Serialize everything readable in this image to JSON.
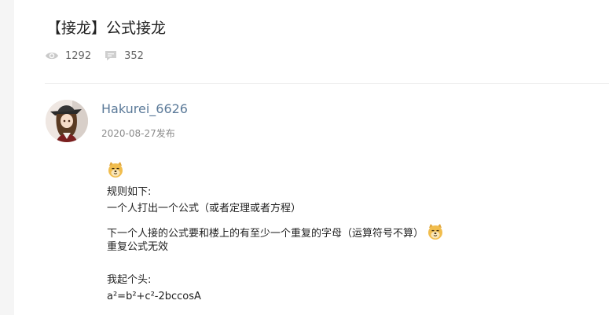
{
  "post": {
    "title": "【接龙】公式接龙",
    "views": "1292",
    "replies": "352"
  },
  "author": {
    "name": "Hakurei_6626",
    "date": "2020-08-27发布"
  },
  "content": {
    "emoji_name": "doge-emoji",
    "lines": [
      "规则如下:",
      "一个人打出一个公式（或者定理或者方程）",
      "下一个人接的公式要和楼上的有至少一个重复的字母（运算符号不算）",
      "重复公式无效",
      "",
      "我起个头:",
      "a²=b²+c²-2bccosA"
    ]
  }
}
